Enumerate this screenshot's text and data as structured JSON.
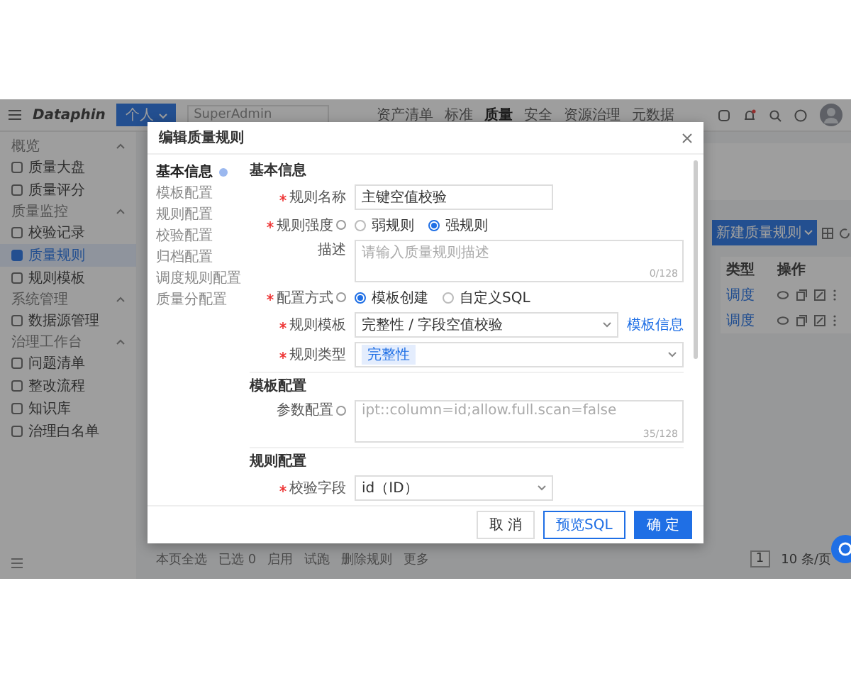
{
  "header": {
    "logo": "Dataphin",
    "workspace": "个人",
    "project": "SuperAdmin",
    "nav": [
      {
        "label": "资产清单",
        "selected": false
      },
      {
        "label": "标准",
        "selected": false
      },
      {
        "label": "质量",
        "selected": true
      },
      {
        "label": "安全",
        "selected": false
      },
      {
        "label": "资源治理",
        "selected": false
      },
      {
        "label": "元数据",
        "selected": false
      }
    ]
  },
  "sidebar": {
    "groups": [
      {
        "label": "概览",
        "expanded": true,
        "children": [
          {
            "label": "质量大盘",
            "selected": false
          },
          {
            "label": "质量评分",
            "selected": false
          }
        ]
      },
      {
        "label": "质量监控",
        "expanded": true,
        "children": [
          {
            "label": "校验记录",
            "selected": false
          },
          {
            "label": "质量规则",
            "selected": true
          },
          {
            "label": "规则模板",
            "selected": false
          }
        ]
      },
      {
        "label": "系统管理",
        "expanded": true,
        "children": [
          {
            "label": "数据源管理",
            "selected": false
          }
        ]
      },
      {
        "label": "治理工作台",
        "expanded": true,
        "children": [
          {
            "label": "问题清单",
            "selected": false
          },
          {
            "label": "整改流程",
            "selected": false
          },
          {
            "label": "知识库",
            "selected": false
          },
          {
            "label": "治理白名单",
            "selected": false
          }
        ]
      }
    ]
  },
  "page": {
    "new_button": "新建质量规则",
    "columns": [
      "类型",
      "操作"
    ],
    "rows": [
      {
        "type": "调度"
      },
      {
        "type": "调度"
      }
    ],
    "bulk": [
      "本页全选",
      "已选 0",
      "启用",
      "试跑",
      "删除规则",
      "更多"
    ],
    "page": "1",
    "page_size": "10 条/页"
  },
  "modal": {
    "title": "编辑质量规则",
    "nav": [
      {
        "label": "基本信息",
        "selected": true
      },
      {
        "label": "模板配置",
        "selected": false
      },
      {
        "label": "规则配置",
        "selected": false
      },
      {
        "label": "校验配置",
        "selected": false
      },
      {
        "label": "归档配置",
        "selected": false
      },
      {
        "label": "调度规则配置",
        "selected": false
      },
      {
        "label": "质量分配置",
        "selected": false
      }
    ],
    "sections": [
      {
        "title": "基本信息",
        "fields": [
          {
            "kind": "input",
            "label": "规则名称",
            "required": true,
            "value": "主键空值校验"
          },
          {
            "kind": "radio",
            "label": "规则强度",
            "required": true,
            "info": true,
            "options": [
              {
                "label": "弱规则",
                "selected": false
              },
              {
                "label": "强规则",
                "selected": true
              }
            ]
          },
          {
            "kind": "textarea",
            "label": "描述",
            "required": false,
            "placeholder": "请输入质量规则描述",
            "counter": "0/128"
          },
          {
            "kind": "radio",
            "label": "配置方式",
            "required": true,
            "info": true,
            "options": [
              {
                "label": "模板创建",
                "selected": true
              },
              {
                "label": "自定义SQL",
                "selected": false
              }
            ]
          },
          {
            "kind": "select",
            "label": "规则模板",
            "required": true,
            "value": "完整性 / 字段空值校验",
            "link": "模板信息"
          },
          {
            "kind": "tags",
            "label": "规则类型",
            "required": true,
            "tags": [
              "完整性"
            ]
          }
        ]
      },
      {
        "title": "模板配置",
        "fields": [
          {
            "kind": "textarea",
            "label": "参数配置",
            "required": false,
            "info": true,
            "placeholder": "ipt::column=id;allow.full.scan=false",
            "counter": "35/128"
          }
        ]
      },
      {
        "title": "规则配置",
        "fields": [
          {
            "kind": "select",
            "label": "校验字段",
            "required": true,
            "value": "id（ID）"
          }
        ]
      }
    ],
    "buttons": [
      {
        "label": "取 消",
        "kind": "default"
      },
      {
        "label": "预览SQL",
        "kind": "outline"
      },
      {
        "label": "确 定",
        "kind": "primary"
      }
    ]
  }
}
